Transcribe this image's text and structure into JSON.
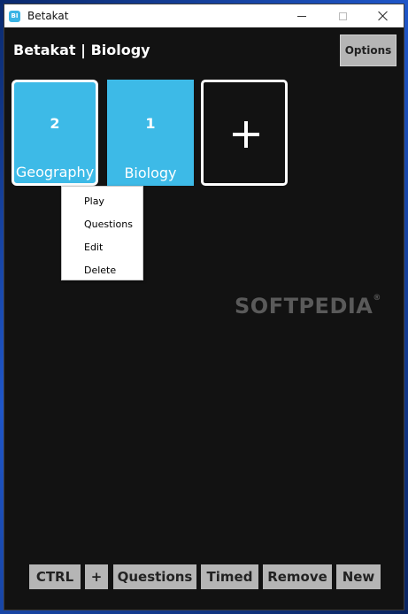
{
  "window": {
    "title": "Betakat",
    "icon_label": "BI",
    "controls": [
      "minimize",
      "maximize",
      "close"
    ]
  },
  "header": {
    "title": "Betakat | Biology",
    "options_label": "Options"
  },
  "decks": [
    {
      "name": "Geography",
      "count": "2",
      "selected": true
    },
    {
      "name": "Biology",
      "count": "1",
      "selected": false
    }
  ],
  "add_deck": {
    "icon": "plus-icon"
  },
  "context_menu": {
    "items": [
      "Play",
      "Questions",
      "Edit",
      "Delete"
    ]
  },
  "watermark": {
    "text": "SOFTPEDIA",
    "mark": "®"
  },
  "toolbar": {
    "buttons": [
      "CTRL",
      "+",
      "Questions",
      "Timed",
      "Remove",
      "New"
    ]
  },
  "colors": {
    "background": "#121212",
    "card": "#3dbae7",
    "button": "#b5b5b5",
    "titlebar": "#ffffff"
  }
}
